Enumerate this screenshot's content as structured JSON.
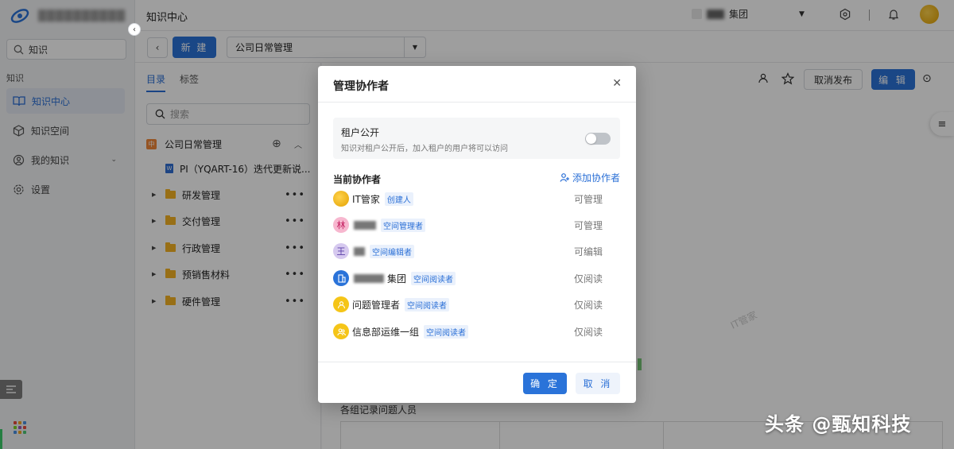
{
  "brand": {
    "name": "██████████"
  },
  "sidebar": {
    "search_value": "知识",
    "section_label": "知识",
    "items": [
      {
        "label": "知识中心",
        "icon": "book-open-icon",
        "active": true
      },
      {
        "label": "知识空间",
        "icon": "cube-icon"
      },
      {
        "label": "我的知识",
        "icon": "user-knowledge-icon",
        "expandable": true
      },
      {
        "label": "设置",
        "icon": "gear-icon"
      }
    ]
  },
  "header": {
    "title": "知识中心",
    "org_name": "集团"
  },
  "toolbar": {
    "new_label": "新 建",
    "space_selected": "公司日常管理"
  },
  "tree": {
    "tabs": [
      {
        "label": "目录",
        "active": true
      },
      {
        "label": "标签"
      }
    ],
    "search_placeholder": "搜索",
    "space_badge": "中",
    "root": "公司日常管理",
    "doc": "PI（YQART-16）迭代更新说...",
    "folders": [
      "研发管理",
      "交付管理",
      "行政管理",
      "预销售材料",
      "硬件管理"
    ]
  },
  "content": {
    "cancel_publish": "取消发布",
    "edit": "编 辑",
    "watermark": "IT管家",
    "heading": "各组记录问题人员"
  },
  "modal": {
    "title": "管理协作者",
    "public": {
      "title": "租户公开",
      "desc": "知识对租户公开后，加入租户的用户将可以访问",
      "enabled": false
    },
    "collab_title": "当前协作者",
    "add_label": "添加协作者",
    "members": [
      {
        "avatar": "",
        "name": "IT管家",
        "tag": "创建人",
        "perm": "可管理",
        "color": "#f2b319"
      },
      {
        "avatar": "林",
        "name": "",
        "tag": "空间管理者",
        "perm": "可管理",
        "color": "#f5a3c0"
      },
      {
        "avatar": "王",
        "name": "",
        "tag": "空间编辑者",
        "perm": "可编辑",
        "color": "#c7b5e8"
      },
      {
        "avatar": "",
        "name": "集团",
        "tag": "空间阅读者",
        "perm": "仅阅读",
        "color": "#2a73d9"
      },
      {
        "avatar": "",
        "name": "问题管理者",
        "tag": "空间阅读者",
        "perm": "仅阅读",
        "color": "#f5c518"
      },
      {
        "avatar": "",
        "name": "信息部运维一组",
        "tag": "空间阅读者",
        "perm": "仅阅读",
        "color": "#f5c518"
      }
    ],
    "ok_label": "确 定",
    "cancel_label": "取 消"
  },
  "credit": "头条 @甄知科技"
}
